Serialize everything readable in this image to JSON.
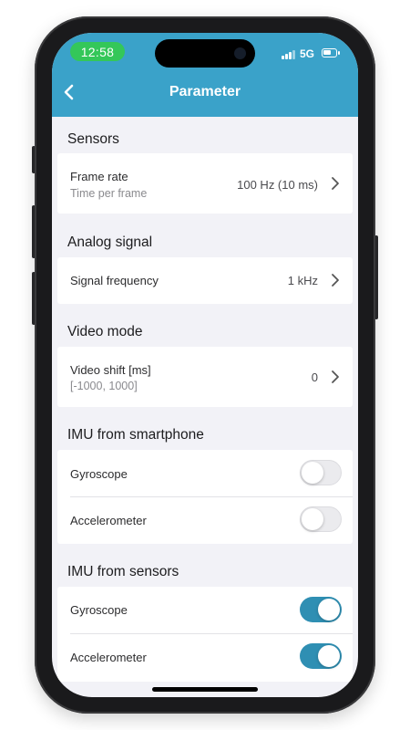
{
  "status_bar": {
    "time": "12:58",
    "network": "5G"
  },
  "header": {
    "title": "Parameter",
    "back_icon": "chevron-left-icon"
  },
  "colors": {
    "accent": "#3aa2c9",
    "toggle_on": "#2f8fb3",
    "time_pill": "#34c759"
  },
  "sections": {
    "sensors": {
      "title": "Sensors",
      "frame_rate": {
        "label": "Frame rate",
        "sublabel": "Time per frame",
        "value": "100 Hz (10 ms)"
      }
    },
    "analog_signal": {
      "title": "Analog signal",
      "signal_frequency": {
        "label": "Signal frequency",
        "value": "1 kHz"
      }
    },
    "video_mode": {
      "title": "Video mode",
      "video_shift": {
        "label": "Video shift [ms]",
        "sublabel": "[-1000, 1000]",
        "value": "0"
      }
    },
    "imu_smartphone": {
      "title": "IMU from smartphone",
      "gyroscope": {
        "label": "Gyroscope",
        "enabled": false
      },
      "accelerometer": {
        "label": "Accelerometer",
        "enabled": false
      }
    },
    "imu_sensors": {
      "title": "IMU from sensors",
      "gyroscope": {
        "label": "Gyroscope",
        "enabled": true
      },
      "accelerometer": {
        "label": "Accelerometer",
        "enabled": true
      }
    }
  }
}
